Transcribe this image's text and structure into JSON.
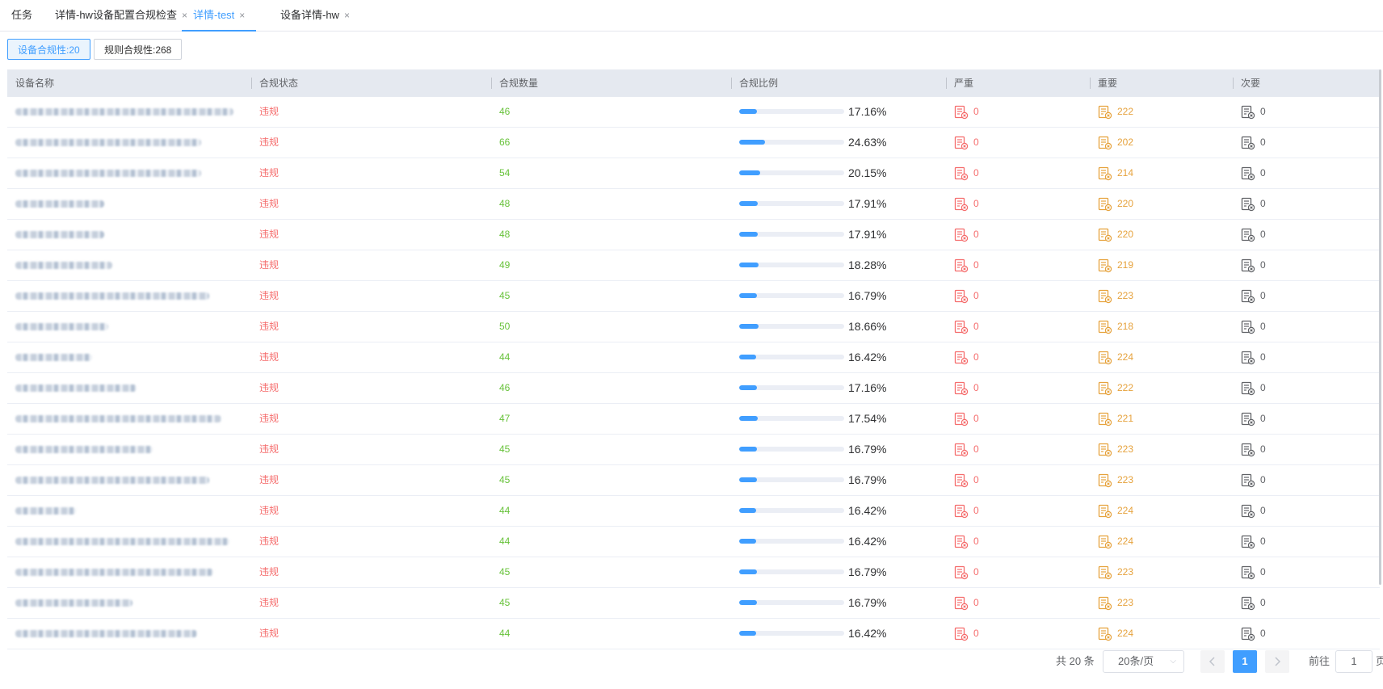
{
  "tabs": [
    {
      "label": "任务",
      "closable": false,
      "active": false
    },
    {
      "label": "详情-hw设备配置合规检查",
      "closable": true,
      "active": false
    },
    {
      "label": "详情-test",
      "closable": true,
      "active": true
    },
    {
      "label": "设备详情-hw",
      "closable": true,
      "active": false
    }
  ],
  "close_glyph": "×",
  "filters": {
    "device_compliance": "设备合规性:20",
    "rule_compliance": "规则合规性:268"
  },
  "columns": {
    "device_name": "设备名称",
    "status": "合规状态",
    "count": "合规数量",
    "ratio": "合规比例",
    "critical": "严重",
    "major": "重要",
    "minor": "次要"
  },
  "rows": [
    {
      "status": "违规",
      "count": "46",
      "ratio": "17.16%",
      "ratio_value": 0.1716,
      "critical": "0",
      "major": "222",
      "minor": "0"
    },
    {
      "status": "违规",
      "count": "66",
      "ratio": "24.63%",
      "ratio_value": 0.2463,
      "critical": "0",
      "major": "202",
      "minor": "0"
    },
    {
      "status": "违规",
      "count": "54",
      "ratio": "20.15%",
      "ratio_value": 0.2015,
      "critical": "0",
      "major": "214",
      "minor": "0"
    },
    {
      "status": "违规",
      "count": "48",
      "ratio": "17.91%",
      "ratio_value": 0.1791,
      "critical": "0",
      "major": "220",
      "minor": "0"
    },
    {
      "status": "违规",
      "count": "48",
      "ratio": "17.91%",
      "ratio_value": 0.1791,
      "critical": "0",
      "major": "220",
      "minor": "0"
    },
    {
      "status": "违规",
      "count": "49",
      "ratio": "18.28%",
      "ratio_value": 0.1828,
      "critical": "0",
      "major": "219",
      "minor": "0"
    },
    {
      "status": "违规",
      "count": "45",
      "ratio": "16.79%",
      "ratio_value": 0.1679,
      "critical": "0",
      "major": "223",
      "minor": "0"
    },
    {
      "status": "违规",
      "count": "50",
      "ratio": "18.66%",
      "ratio_value": 0.1866,
      "critical": "0",
      "major": "218",
      "minor": "0"
    },
    {
      "status": "违规",
      "count": "44",
      "ratio": "16.42%",
      "ratio_value": 0.1642,
      "critical": "0",
      "major": "224",
      "minor": "0"
    },
    {
      "status": "违规",
      "count": "46",
      "ratio": "17.16%",
      "ratio_value": 0.1716,
      "critical": "0",
      "major": "222",
      "minor": "0"
    },
    {
      "status": "违规",
      "count": "47",
      "ratio": "17.54%",
      "ratio_value": 0.1754,
      "critical": "0",
      "major": "221",
      "minor": "0"
    },
    {
      "status": "违规",
      "count": "45",
      "ratio": "16.79%",
      "ratio_value": 0.1679,
      "critical": "0",
      "major": "223",
      "minor": "0"
    },
    {
      "status": "违规",
      "count": "45",
      "ratio": "16.79%",
      "ratio_value": 0.1679,
      "critical": "0",
      "major": "223",
      "minor": "0"
    },
    {
      "status": "违规",
      "count": "44",
      "ratio": "16.42%",
      "ratio_value": 0.1642,
      "critical": "0",
      "major": "224",
      "minor": "0"
    },
    {
      "status": "违规",
      "count": "44",
      "ratio": "16.42%",
      "ratio_value": 0.1642,
      "critical": "0",
      "major": "224",
      "minor": "0"
    },
    {
      "status": "违规",
      "count": "45",
      "ratio": "16.79%",
      "ratio_value": 0.1679,
      "critical": "0",
      "major": "223",
      "minor": "0"
    },
    {
      "status": "违规",
      "count": "45",
      "ratio": "16.79%",
      "ratio_value": 0.1679,
      "critical": "0",
      "major": "223",
      "minor": "0"
    },
    {
      "status": "违规",
      "count": "44",
      "ratio": "16.42%",
      "ratio_value": 0.1642,
      "critical": "0",
      "major": "224",
      "minor": "0"
    }
  ],
  "pagination": {
    "total_text": "共 20 条",
    "page_size": "20条/页",
    "current_page": "1",
    "goto_label": "前往",
    "goto_value": "1",
    "page_suffix": "页"
  },
  "icons": {
    "critical": "report-x-icon",
    "major": "report-x-icon",
    "minor": "report-x-icon",
    "prev": "chevron-left-icon",
    "next": "chevron-right-icon",
    "dropdown": "chevron-down-icon"
  },
  "colors": {
    "accent": "#409eff",
    "violation": "#f56c6c",
    "compliant_count": "#67c23a",
    "major": "#e6a23c",
    "minor": "#606266"
  }
}
